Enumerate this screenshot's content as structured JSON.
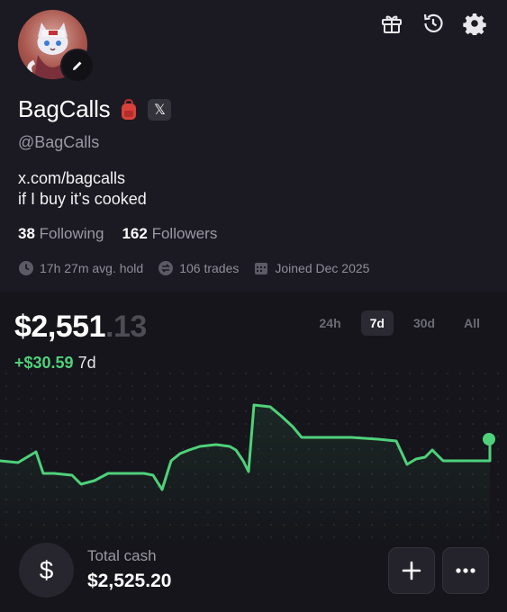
{
  "profile": {
    "name": "BagCalls",
    "handle": "@BagCalls",
    "bio_line1": "x.com/bagcalls",
    "bio_line2": "if I buy it’s cooked",
    "following_count": "38",
    "following_label": "Following",
    "followers_count": "162",
    "followers_label": "Followers",
    "avg_hold": "17h 27m avg. hold",
    "trades": "106 trades",
    "joined": "Joined Dec 2025",
    "x_badge": "𝕏"
  },
  "portfolio": {
    "balance_main": "$2,551",
    "balance_cents": ".13",
    "change_value": "+$30.59",
    "change_period": "7d",
    "ranges": [
      "24h",
      "7d",
      "30d",
      "All"
    ],
    "active_range": "7d",
    "line_color": "#4fd17a"
  },
  "cash": {
    "icon_symbol": "$",
    "label": "Total cash",
    "value": "$2,525.20"
  },
  "actions": {
    "add_symbol": "+",
    "more_symbol": "•••"
  },
  "icons": [
    "edit-icon",
    "gift-icon",
    "history-icon",
    "gear-icon",
    "backpack-icon",
    "x-logo-icon",
    "clock-icon",
    "swap-icon",
    "calendar-icon",
    "dollar-icon",
    "plus-icon",
    "more-icon"
  ]
}
